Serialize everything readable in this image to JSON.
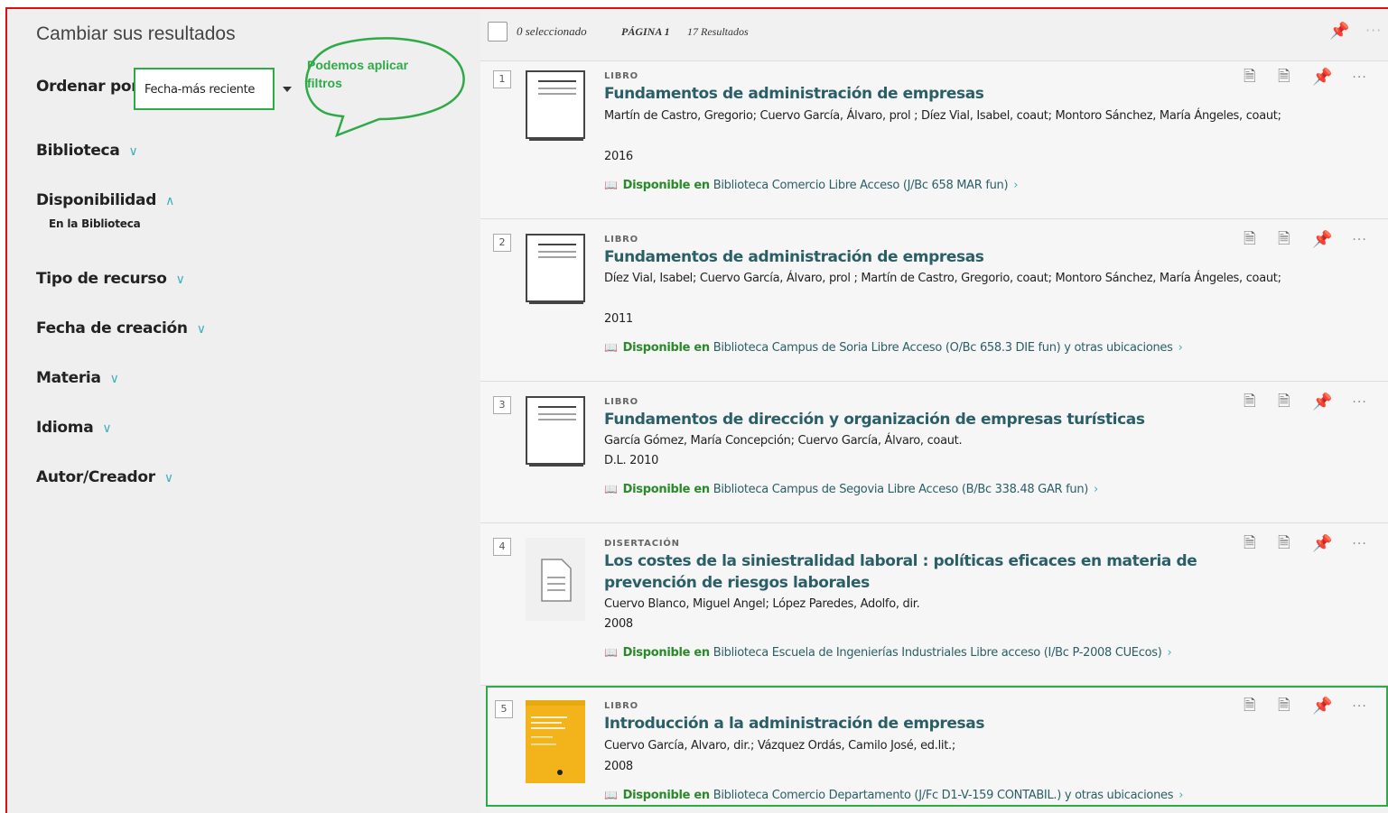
{
  "sidebar": {
    "title": "Cambiar sus resultados",
    "sort_label": "Ordenar por",
    "sort_value": "Fecha-más reciente",
    "annotation": "Podemos aplicar filtros",
    "facets": [
      {
        "label": "Biblioteca",
        "chevron": "∨"
      },
      {
        "label": "Disponibilidad",
        "chevron": "∧"
      },
      {
        "label": "Tipo de recurso",
        "chevron": "∨"
      },
      {
        "label": "Fecha de creación",
        "chevron": "∨"
      },
      {
        "label": "Materia",
        "chevron": "∨"
      },
      {
        "label": "Idioma",
        "chevron": "∨"
      },
      {
        "label": "Autor/Creador",
        "chevron": "∨"
      }
    ],
    "availability_option": "En la Biblioteca"
  },
  "toolbar": {
    "selected": "0 seleccionado",
    "page": "PÁGINA 1",
    "results": "17 Resultados"
  },
  "results": [
    {
      "num": "1",
      "type": "LIBRO",
      "title": "Fundamentos de administración de empresas",
      "authors": "Martín de Castro, Gregorio; Cuervo García, Álvaro, prol ; Díez Vial, Isabel, coaut; Montoro Sánchez, María Ángeles, coaut;",
      "year": "2016",
      "status": "Disponible en",
      "location": "Biblioteca Comercio  Libre Acceso (J/Bc 658 MAR fun)"
    },
    {
      "num": "2",
      "type": "LIBRO",
      "title": "Fundamentos de administración de empresas",
      "authors": "Díez Vial, Isabel; Cuervo García, Álvaro, prol ; Martín de Castro, Gregorio, coaut; Montoro Sánchez, María Ángeles, coaut;",
      "year": "2011",
      "status": "Disponible en",
      "location": "Biblioteca Campus de Soria  Libre Acceso (O/Bc 658.3 DIE fun) y otras ubicaciones"
    },
    {
      "num": "3",
      "type": "LIBRO",
      "title": "Fundamentos de dirección y organización de empresas turísticas",
      "authors": "García Gómez, María Concepción; Cuervo García, Álvaro, coaut.",
      "year": "D.L. 2010",
      "status": "Disponible en",
      "location": "Biblioteca Campus de Segovia  Libre Acceso (B/Bc 338.48 GAR fun)"
    },
    {
      "num": "4",
      "type": "DISERTACIÓN",
      "title": "Los costes de la siniestralidad laboral : políticas eficaces en materia de prevención de riesgos laborales",
      "authors": "Cuervo Blanco, Miguel Angel; López Paredes, Adolfo, dir.",
      "year": "2008",
      "status": "Disponible en",
      "location": "Biblioteca Escuela de Ingenierías Industriales  Libre acceso (I/Bc P-2008 CUEcos)"
    },
    {
      "num": "5",
      "type": "LIBRO",
      "title": "Introducción a la administración de empresas",
      "authors": "Cuervo García, Alvaro, dir.; Vázquez Ordás, Camilo José, ed.lit.;",
      "year": "2008",
      "status": "Disponible en",
      "location": "Biblioteca Comercio  Departamento (J/Fc D1-V-159 CONTABIL.) y otras ubicaciones"
    }
  ],
  "colors": {
    "highlight_green": "#2eaa47",
    "title_teal": "#2b5f67",
    "available_green": "#2a8a2a",
    "frame_red": "#dd1111"
  }
}
